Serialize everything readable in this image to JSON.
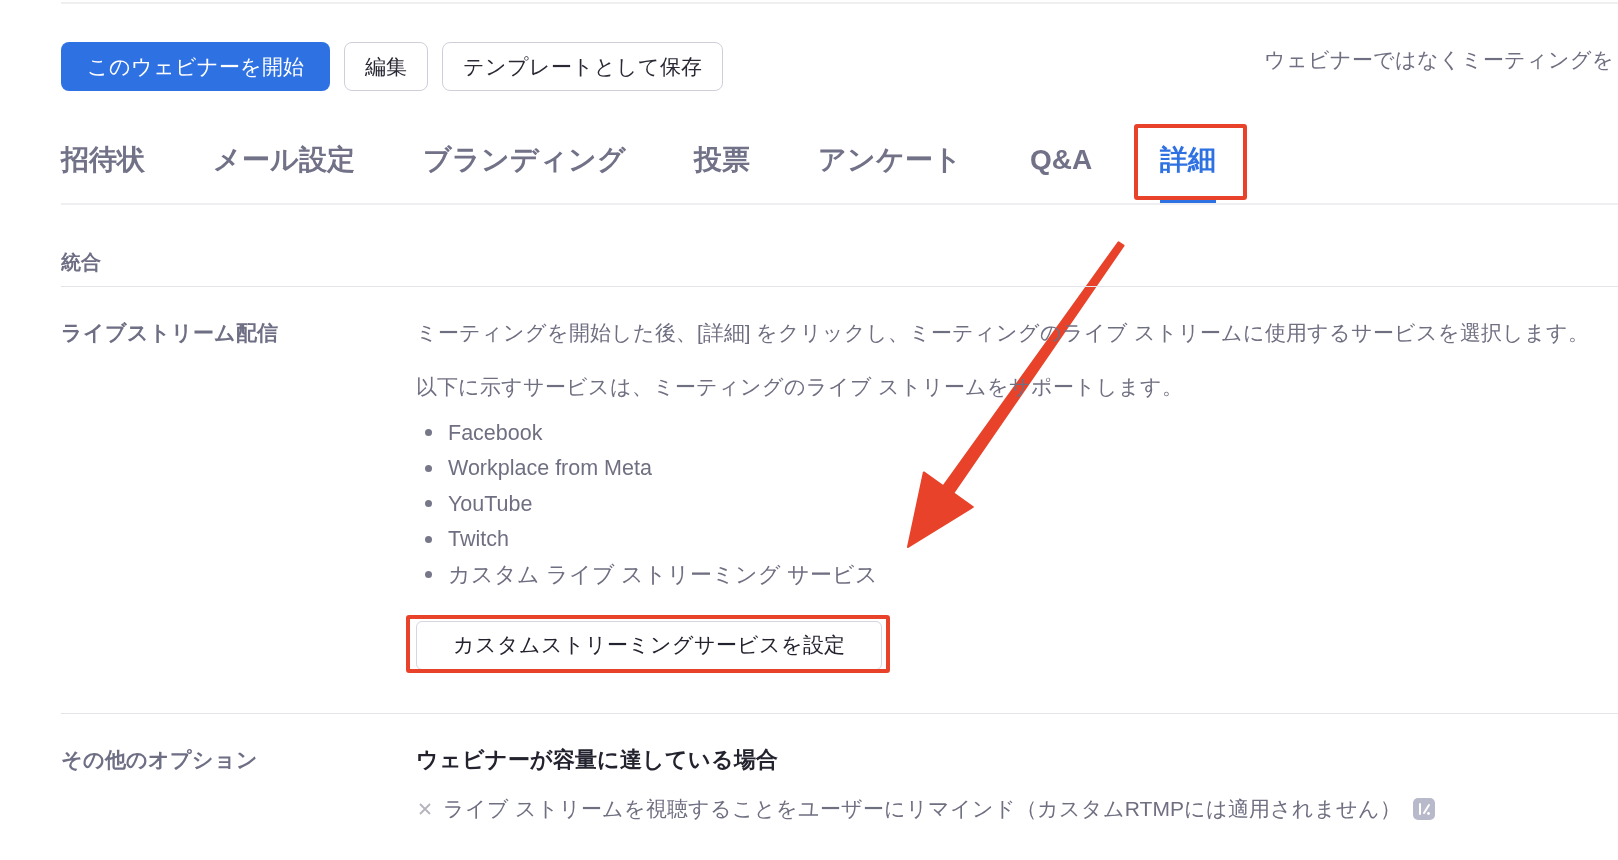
{
  "toolbar": {
    "buttons": [
      {
        "label": "このウェビナーを開始",
        "kind": "primary"
      },
      {
        "label": "編集",
        "kind": "secondary"
      },
      {
        "label": "テンプレートとして保存",
        "kind": "secondary"
      }
    ],
    "note": "ウェビナーではなくミーティングを"
  },
  "tabs": [
    {
      "label": "招待状",
      "selected": false,
      "highlighted": false
    },
    {
      "label": "メール設定",
      "selected": false,
      "highlighted": false
    },
    {
      "label": "ブランディング",
      "selected": false,
      "highlighted": false
    },
    {
      "label": "投票",
      "selected": false,
      "highlighted": false
    },
    {
      "label": "アンケート",
      "selected": false,
      "highlighted": false
    },
    {
      "label": "Q&A",
      "selected": false,
      "highlighted": false
    },
    {
      "label": "詳細",
      "selected": true,
      "highlighted": true
    }
  ],
  "section_title": "統合",
  "settings": [
    {
      "kind": "live_stream",
      "label": "ライブストリーム配信",
      "paragraphs": [
        "ミーティングを開始した後、[詳細] をクリックし、ミーティングのライブ ストリームに使用するサービスを選択します。",
        "以下に示すサービスは、ミーティングのライブ ストリームをサポートします。"
      ],
      "services": [
        "Facebook",
        "Workplace from Meta",
        "YouTube",
        "Twitch",
        "カスタム ライブ ストリーミング サービス"
      ],
      "button": {
        "label": "カスタムストリーミングサービスを設定",
        "highlighted": true
      }
    },
    {
      "kind": "options",
      "label": "その他のオプション",
      "heading": "ウェビナーが容量に達している場合",
      "options": [
        {
          "label": "ライブ ストリームを視聴することをユーザーにリマインド（カスタムRTMPには適用されません）",
          "enabled": false
        }
      ]
    }
  ]
}
